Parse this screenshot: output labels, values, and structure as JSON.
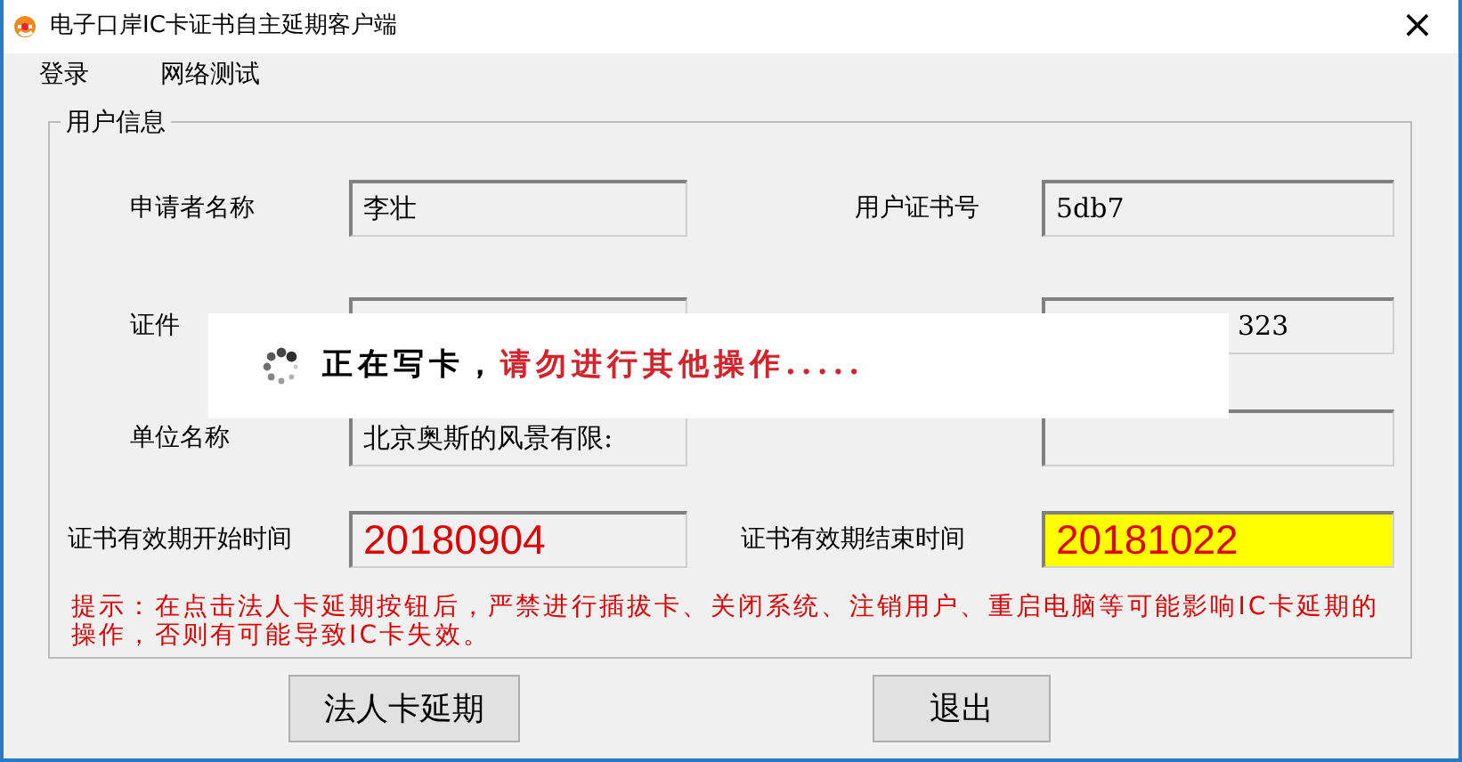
{
  "window": {
    "title": "电子口岸IC卡证书自主延期客户端",
    "close": "×"
  },
  "menu": [
    "登录",
    "网络测试"
  ],
  "group": {
    "title": "用户信息",
    "rows": [
      {
        "left": {
          "label": "申请者名称",
          "value": "李壮",
          "kind": "text"
        },
        "right": {
          "label": "用户证书号",
          "value": "5db7",
          "kind": "text"
        }
      },
      {
        "left": {
          "label": "证件",
          "kind": "text"
        },
        "right": {
          "value": "323",
          "kind": "text"
        }
      },
      {
        "left": {
          "label": "单位名称",
          "value": "北京奥斯的风景有限:",
          "kind": "text"
        },
        "right": {
          "kind": "text"
        }
      },
      {
        "left": {
          "label": "证书有效期开始时间",
          "value": "20180904",
          "kind": "date",
          "highlighted": false
        },
        "right": {
          "label": "证书有效期结束时间",
          "value": "20181022",
          "kind": "date",
          "highlighted": true
        }
      }
    ],
    "hint": "提示：在点击法人卡延期按钮后，严禁进行插拔卡、关闭系统、注销用户、重启电脑等可能影响IC卡延期的操作，否则有可能导致IC卡失效。"
  },
  "buttons": [
    "法人卡延期",
    "退出"
  ],
  "overlay": {
    "status": "正在写卡，",
    "warning": "请勿进行其他操作....."
  }
}
